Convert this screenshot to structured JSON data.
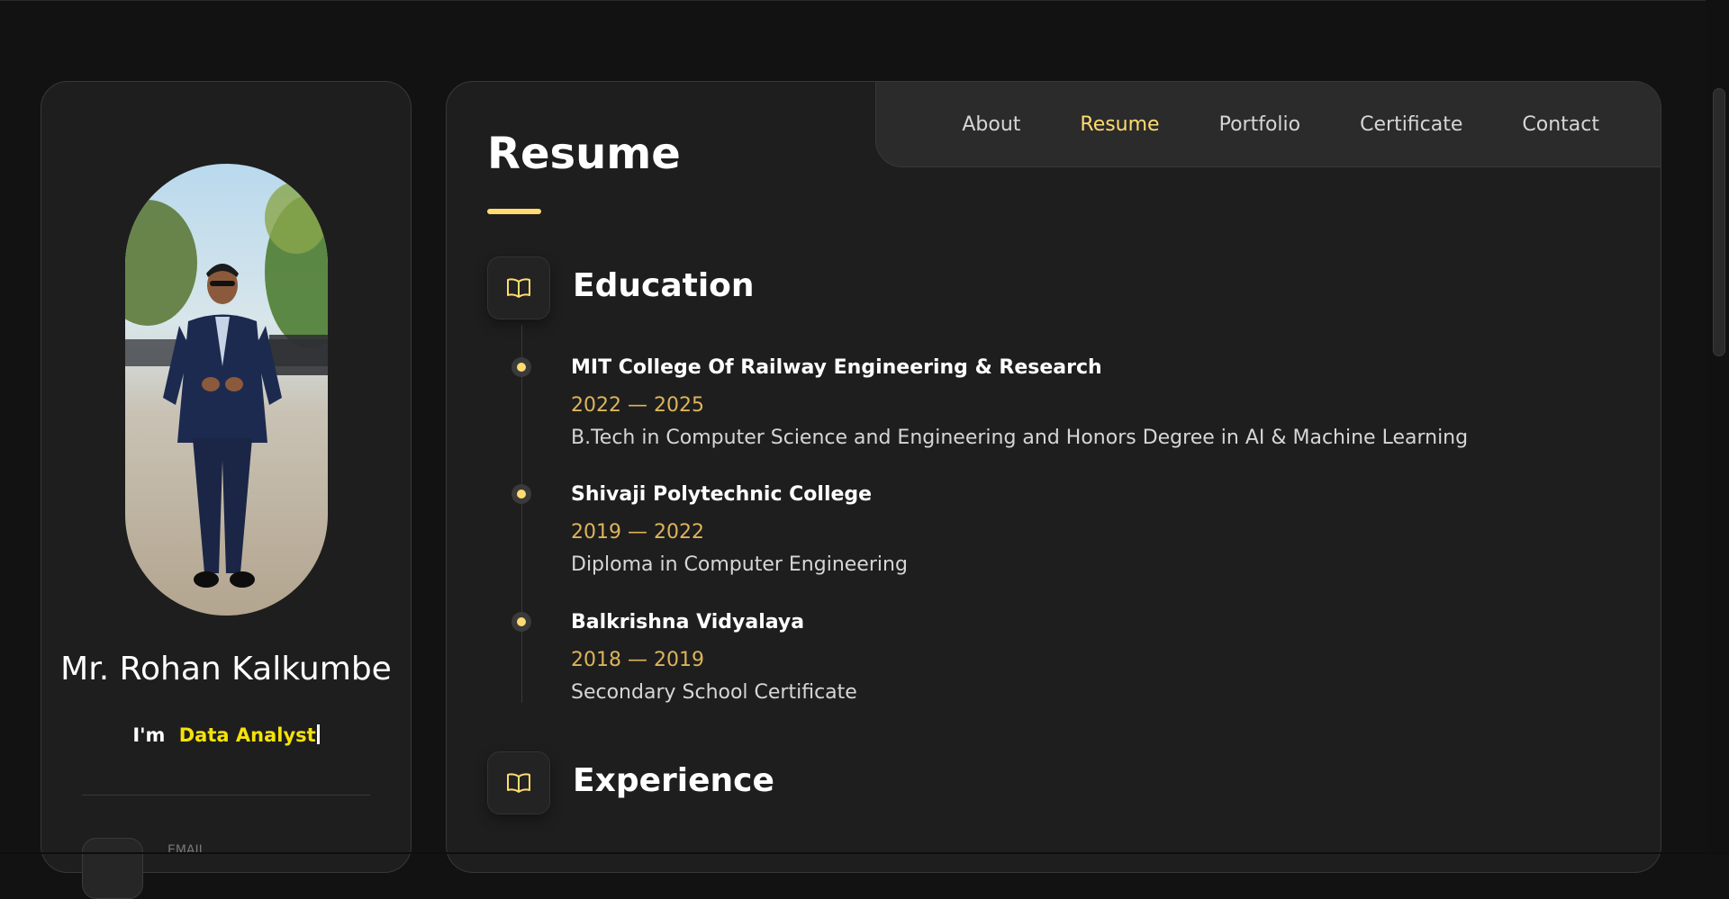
{
  "profile": {
    "name": "Mr. Rohan Kalkumbe",
    "tagline_prefix": "I'm",
    "tagline_role": "Data Analyst",
    "contact_label": "EMAIL"
  },
  "nav": {
    "items": [
      "About",
      "Resume",
      "Portfolio",
      "Certificate",
      "Contact"
    ],
    "active": "Resume"
  },
  "resume": {
    "title": "Resume",
    "education": {
      "heading": "Education",
      "icon": "book-icon",
      "items": [
        {
          "title": "MIT College Of Railway Engineering & Research",
          "dates": "2022 — 2025",
          "description": "B.Tech in Computer Science and Engineering and Honors Degree in AI & Machine Learning"
        },
        {
          "title": "Shivaji Polytechnic College",
          "dates": "2019 — 2022",
          "description": "Diploma in Computer Engineering"
        },
        {
          "title": "Balkrishna Vidyalaya",
          "dates": "2018 — 2019",
          "description": "Secondary School Certificate"
        }
      ]
    },
    "experience": {
      "heading": "Experience",
      "icon": "book-icon"
    }
  },
  "colors": {
    "accent": "#ffdb70",
    "role_highlight": "#f4e20a",
    "panel_bg": "#1e1e1e",
    "page_bg": "#121212"
  }
}
